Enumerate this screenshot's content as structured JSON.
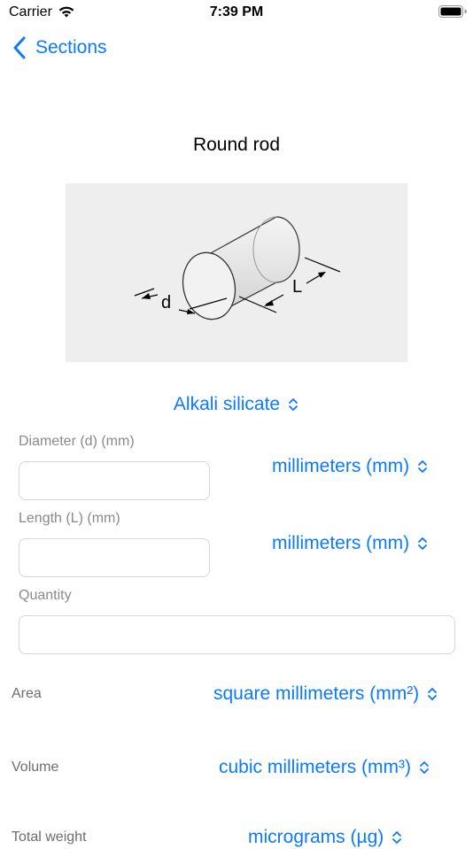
{
  "status_bar": {
    "carrier": "Carrier",
    "time": "7:39 PM"
  },
  "nav": {
    "back_label": "Sections"
  },
  "title": "Round rod",
  "diagram": {
    "diameter_label": "d",
    "length_label": "L"
  },
  "material": {
    "selected": "Alkali silicate"
  },
  "inputs": {
    "diameter": {
      "label": "Diameter (d) (mm)",
      "value": "",
      "unit": "millimeters (mm)"
    },
    "length": {
      "label": "Length (L) (mm)",
      "value": "",
      "unit": "millimeters (mm)"
    },
    "quantity": {
      "label": "Quantity",
      "value": ""
    }
  },
  "results": {
    "area": {
      "label": "Area",
      "unit": "square millimeters (mm²)"
    },
    "volume": {
      "label": "Volume",
      "unit": "cubic millimeters (mm³)"
    },
    "total_weight": {
      "label": "Total weight",
      "unit": "micrograms (µg)"
    }
  },
  "accent_color": "#0a7aff",
  "icons": {
    "wifi": "wifi-icon",
    "battery": "battery-icon",
    "back": "chevron-left-icon",
    "updown": "chevron-up-down-icon"
  }
}
